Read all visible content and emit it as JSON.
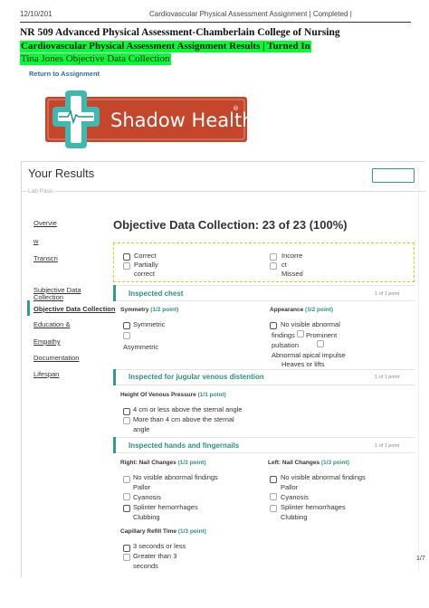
{
  "print_header": {
    "date": "12/10/201",
    "title": "Cardiovascular Physical Assessment Assignment | Completed |"
  },
  "course_title": "NR 509 Advanced Physical Assessment-Chamberlain College of Nursing",
  "highlight_line1": "Cardiovascular Physical Assessment Assignment Results | Turned In",
  "highlight_line2": "Tina Jones Objective Data Collection",
  "return_link": "Return to Assignment",
  "logo": {
    "text": "Shadow Health",
    "registered": "®",
    "colors": {
      "orange": "#c5472b",
      "teal": "#41b7b1"
    }
  },
  "results": {
    "heading": "Your Results",
    "lab_pass": "Lab Pass"
  },
  "sidebar": {
    "items": [
      {
        "label_a": "Overvie",
        "label_b": "w"
      },
      {
        "label": "Transcri"
      },
      {
        "label_a": "Subjective Data",
        "label_b": "Collection"
      },
      {
        "label": "Objective Data Collection"
      },
      {
        "label": "Education &"
      },
      {
        "label": "Empathy"
      },
      {
        "label": "Documentation"
      },
      {
        "label": "Lifespan"
      }
    ]
  },
  "main": {
    "title": "Objective Data Collection: 23 of 23 (100%)",
    "legend": {
      "correct": "Correct",
      "partial_a": "Partially",
      "partial_b": "correct",
      "incorrect_a": "Incorre",
      "incorrect_b": "ct",
      "missed": "Missed"
    },
    "sections": [
      {
        "title": "Inspected chest",
        "count": "1 of 1 point",
        "symmetry": {
          "label": "Symmetry",
          "points": "(1/2 point)",
          "options": [
            "Symmetric",
            "Asymmetric"
          ]
        },
        "appearance": {
          "label": "Appearance",
          "points": "(1/2 point)",
          "options": [
            "No visible abnormal",
            "findings",
            "Prominent",
            "pulsation",
            "Abnormal apical impulse",
            "Heaves or lifts"
          ]
        }
      },
      {
        "title": "Inspected for jugular venous distention",
        "count": "1 of 1 point",
        "question": {
          "label": "Height Of Venous Pressure",
          "points": "(1/1 point)"
        },
        "options": [
          "4 cm or less above the sternal angle",
          "More than 4 cm above the sternal",
          "angle"
        ]
      },
      {
        "title": "Inspected hands and fingernails",
        "count": "1 of 1 point",
        "right": {
          "label": "Right: Nail Changes",
          "points": "(1/3 point)",
          "options": [
            "No visible abnormal findings",
            "Pallor",
            "Cyanosis",
            "Splinter hemorrhages",
            "Clubbing"
          ]
        },
        "left": {
          "label": "Left: Nail Changes",
          "points": "(1/3 point)",
          "options": [
            "No visible abnormal findings",
            "Pallor",
            "Cyanosis",
            "Splinter hemorrhages",
            "Clubbing"
          ]
        },
        "refill": {
          "label": "Capillary Refill Time",
          "points": "(1/3 point)",
          "options": [
            "3 seconds or less",
            "Greater than 3",
            "seconds"
          ]
        }
      }
    ]
  },
  "page_num": "1/7"
}
